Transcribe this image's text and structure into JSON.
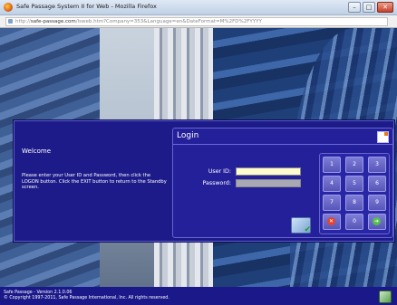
{
  "window": {
    "title": "Safe Passage System II for Web - Mozilla Firefox",
    "controls": [
      "minimize",
      "maximize",
      "close"
    ]
  },
  "address_bar": {
    "url_prefix": "http://",
    "url_domain": "safe-passage.com",
    "url_path": "/lsweb.htm?Company=353&Language=en&DateFormat=M%2FD%2FYYYY"
  },
  "welcome": {
    "heading": "Welcome",
    "text": "Please enter your User ID and Password, then click the LOGON button. Click the EXIT button to return to the Standby screen."
  },
  "login": {
    "title": "Login",
    "user_id_label": "User ID:",
    "password_label": "Password:",
    "user_id_value": "",
    "password_value": "",
    "help_icon": "help-page-icon",
    "logon_icon": "logon-check-icon"
  },
  "keypad": {
    "keys": [
      "1",
      "2",
      "3",
      "4",
      "5",
      "6",
      "7",
      "8",
      "9",
      "✕",
      "0",
      "➜"
    ]
  },
  "footer": {
    "version": "Safe Passage - Version 2.1.0.06",
    "copyright": "© Copyright 1997-2011, Safe Passage International, Inc. All rights reserved.",
    "exit_icon": "exit-icon"
  }
}
